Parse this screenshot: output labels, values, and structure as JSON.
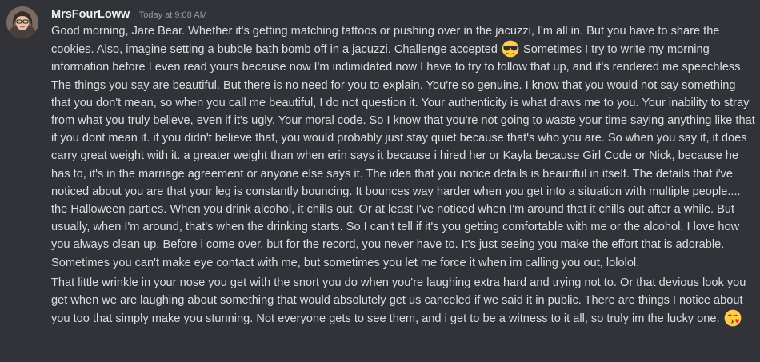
{
  "message": {
    "author": "MrsFourLoww",
    "timestamp": "Today at 9:08 AM",
    "paragraph1": {
      "part1": "Good morning, Jare Bear. Whether it's getting matching tattoos or pushing over in the jacuzzi, I'm all in. But you have to share the cookies. Also, imagine setting a bubble bath bomb off in a jacuzzi. Challenge accepted",
      "emoji1": "sunglasses-emoji",
      "part2": " Sometimes I try to write my morning information before I even read yours because now I'm indimidated.now I have to try to follow that up, and it's rendered me speechless. The things you say are beautiful. But there is no need for you to explain. You're so genuine. I know that you would not say something that you don't mean, so when you call me beautiful, I do not question it. Your authenticity is what draws me to you. Your inability to stray from what you truly believe, even if it's ugly. Your moral code. So I know that you're not going to waste your time saying anything like that if you dont mean it. if you didn't believe that, you would probably just stay quiet because that's who you are. So when you say it, it does carry great weight with it. a greater weight than when erin says it because i hired her or Kayla because Girl Code or Nick, because he has to, it's in the marriage agreement or anyone else says it. The idea that you notice details is beautiful in itself. The details that i've noticed about you are that your leg is constantly bouncing. It bounces way harder when you get into a situation with multiple people.... the Halloween parties. When you drink alcohol, it chills out. Or at least I've noticed when I'm around that it chills out after a while. But usually, when I'm around, that's when the drinking starts. So I can't tell if it's you getting comfortable with me or the alcohol. I love how you always clean up. Before i come over, but for the record, you never have to. It's just seeing you make the effort that is adorable. Sometimes you can't make eye contact with me, but sometimes you let me force it when im calling you out, lololol."
    },
    "paragraph2": {
      "text": "That little wrinkle in your nose you get with the snort you do when you're laughing extra hard and trying not to. Or that devious look you get when we are laughing about something that would absolutely get us canceled if we said it in public. There are things I notice about you too that simply make you stunning. Not everyone gets to see them, and i get to be a witness to it all, so truly im the lucky one. ",
      "emoji2": "face-blowing-kiss-emoji"
    }
  },
  "colors": {
    "background": "#313338",
    "username": "#f2f3f5",
    "timestamp": "#949ba4",
    "text": "#dbdee1",
    "emoji_yellow": "#ffcc4d"
  }
}
